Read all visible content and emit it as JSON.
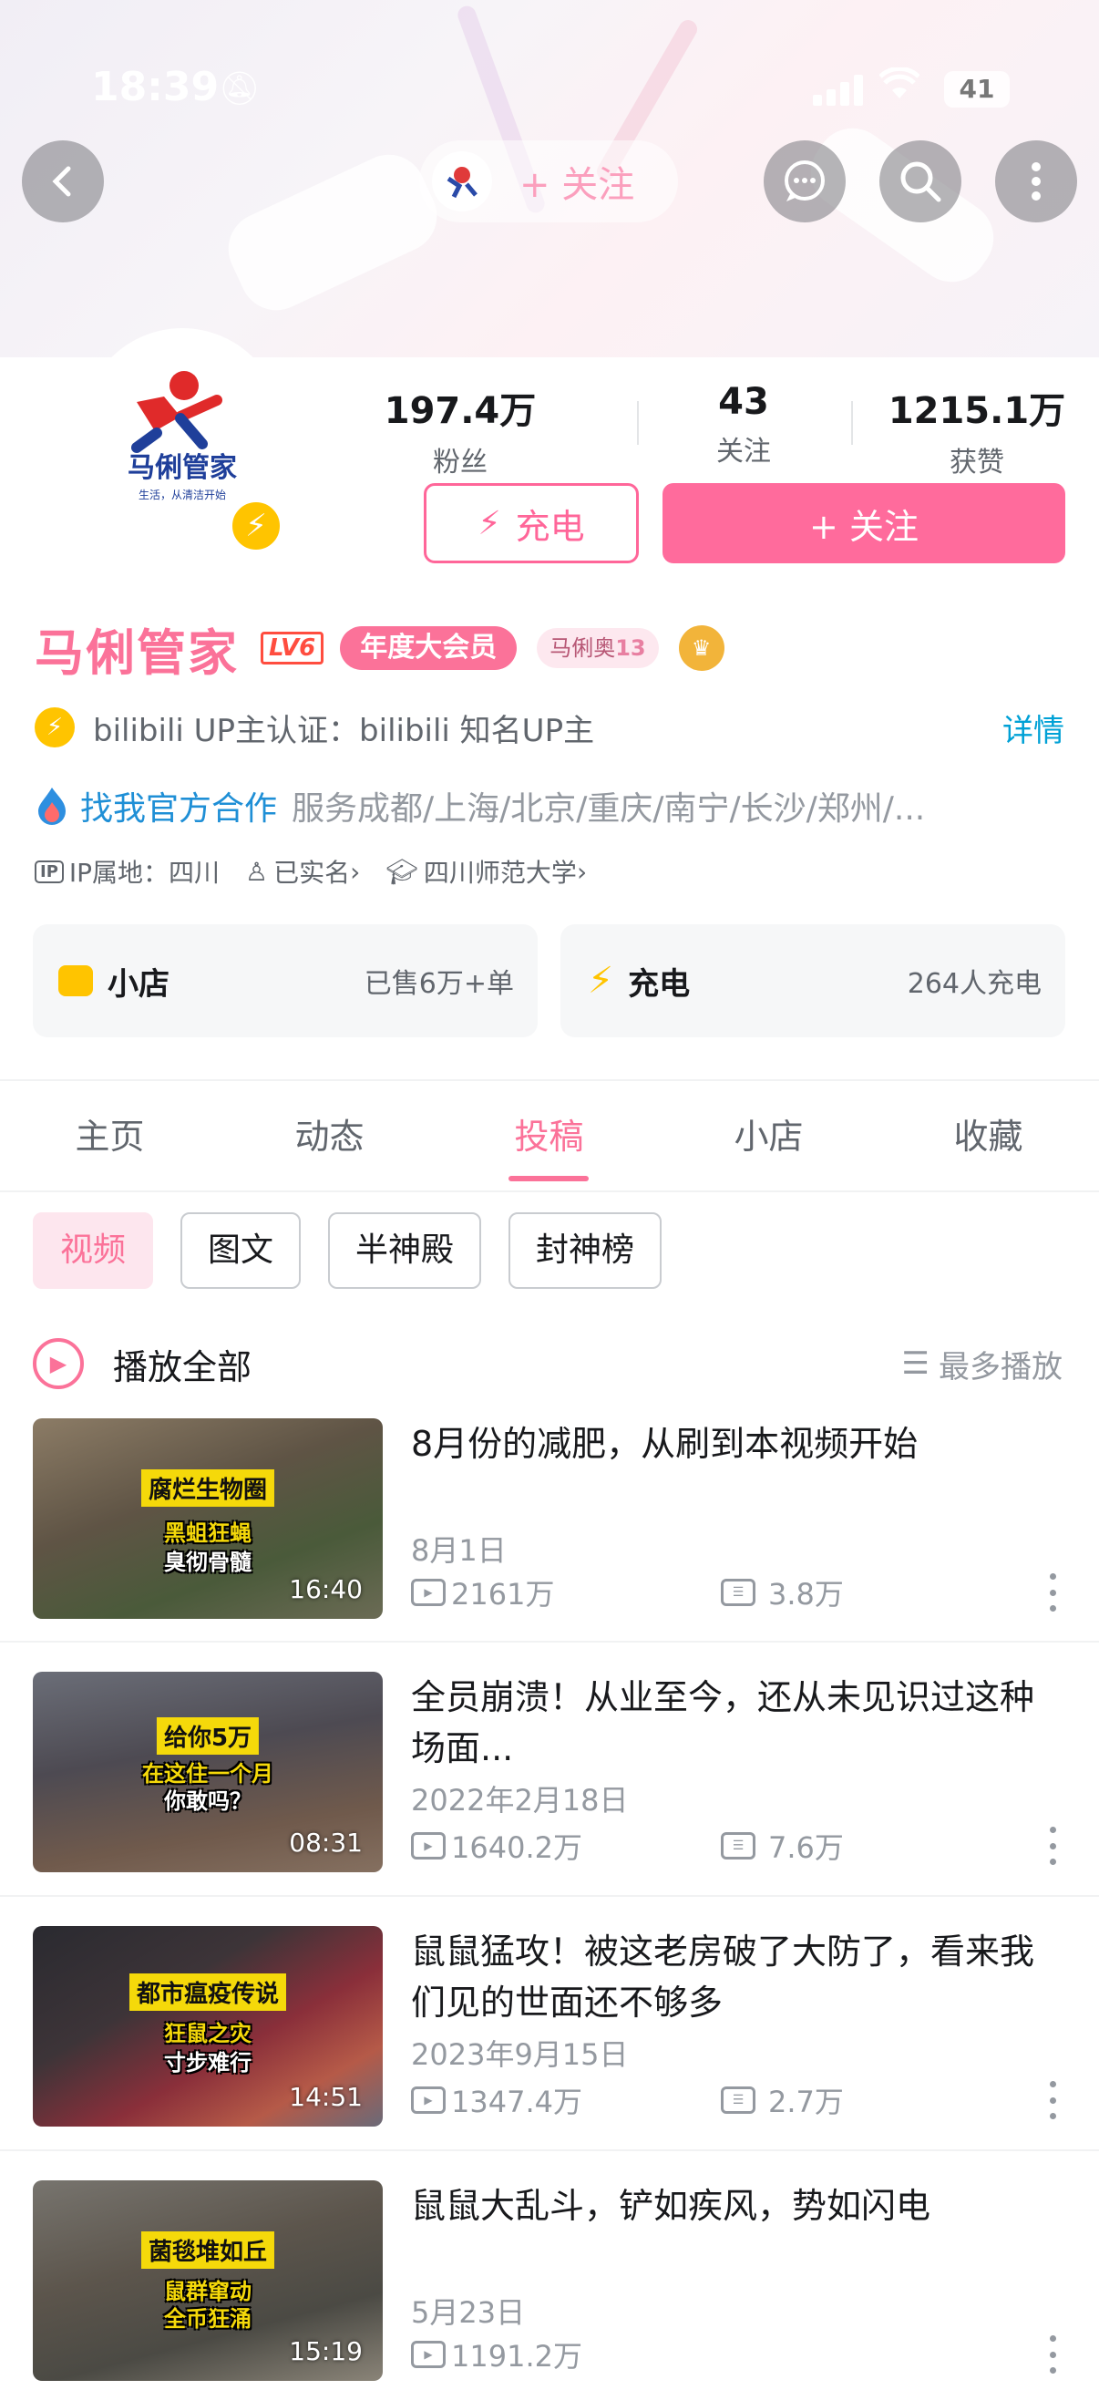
{
  "status_bar": {
    "time": "18:39",
    "battery": "41"
  },
  "top_nav": {
    "follow_label": "+ 关注"
  },
  "profile": {
    "name": "马俐管家",
    "level_badge": "LV6",
    "vip_badge": "年度大会员",
    "fan_medal_name": "马俐奥",
    "fan_medal_level": "13",
    "logo_text": "马俐管家",
    "logo_slogan": "生活，从清洁开始",
    "stats": [
      {
        "value": "197.4万",
        "label": "粉丝"
      },
      {
        "value": "43",
        "label": "关注"
      },
      {
        "value": "1215.1万",
        "label": "获赞"
      }
    ],
    "charge_button": "充电",
    "follow_button": "+ 关注",
    "certification": "bilibili UP主认证：bilibili 知名UP主",
    "certification_detail": "详情",
    "business_link": "找我官方合作",
    "business_cities": "服务成都/上海/北京/重庆/南宁/长沙/郑州/...",
    "ip_label": "IP属地：四川",
    "real_name": "已实名",
    "school": "四川师范大学"
  },
  "cards": {
    "shop": {
      "title": "小店",
      "info": "已售6万+单"
    },
    "charge": {
      "title": "充电",
      "info": "264人充电"
    }
  },
  "tabs": [
    "主页",
    "动态",
    "投稿",
    "小店",
    "收藏"
  ],
  "active_tab": "投稿",
  "chips": [
    "视频",
    "图文",
    "半神殿",
    "封神榜"
  ],
  "play_all": {
    "label": "播放全部",
    "sort": "最多播放"
  },
  "videos": [
    {
      "title": "8月份的减肥，从刷到本视频开始",
      "date": "8月1日",
      "views": "2161万",
      "danmaku": "3.8万",
      "duration": "16:40",
      "thumb_caption": [
        "腐烂生物圈",
        "黑蛆狂蝇",
        "臭彻骨髓"
      ]
    },
    {
      "title": "全员崩溃！从业至今，还从未见识过这种场面...",
      "date": "2022年2月18日",
      "views": "1640.2万",
      "danmaku": "7.6万",
      "duration": "08:31",
      "thumb_caption": [
        "给你5万",
        "在这住一个月",
        "你敢吗？"
      ]
    },
    {
      "title": "鼠鼠猛攻！被这老房破了大防了，看来我们见的世面还不够多",
      "date": "2023年9月15日",
      "views": "1347.4万",
      "danmaku": "2.7万",
      "duration": "14:51",
      "thumb_caption": [
        "都市瘟疫传说",
        "狂鼠之灾",
        "寸步难行"
      ]
    },
    {
      "title": "鼠鼠大乱斗，铲如疾风，势如闪电",
      "date": "5月23日",
      "views": "1191.2万",
      "danmaku": "",
      "duration": "15:19",
      "thumb_caption": [
        "菌毯堆如丘",
        "鼠群窜动",
        "全币狂涌"
      ]
    }
  ],
  "colors": {
    "brand_pink": "#fb7299",
    "link_blue": "#00a1d6",
    "gold": "#ffc400"
  }
}
